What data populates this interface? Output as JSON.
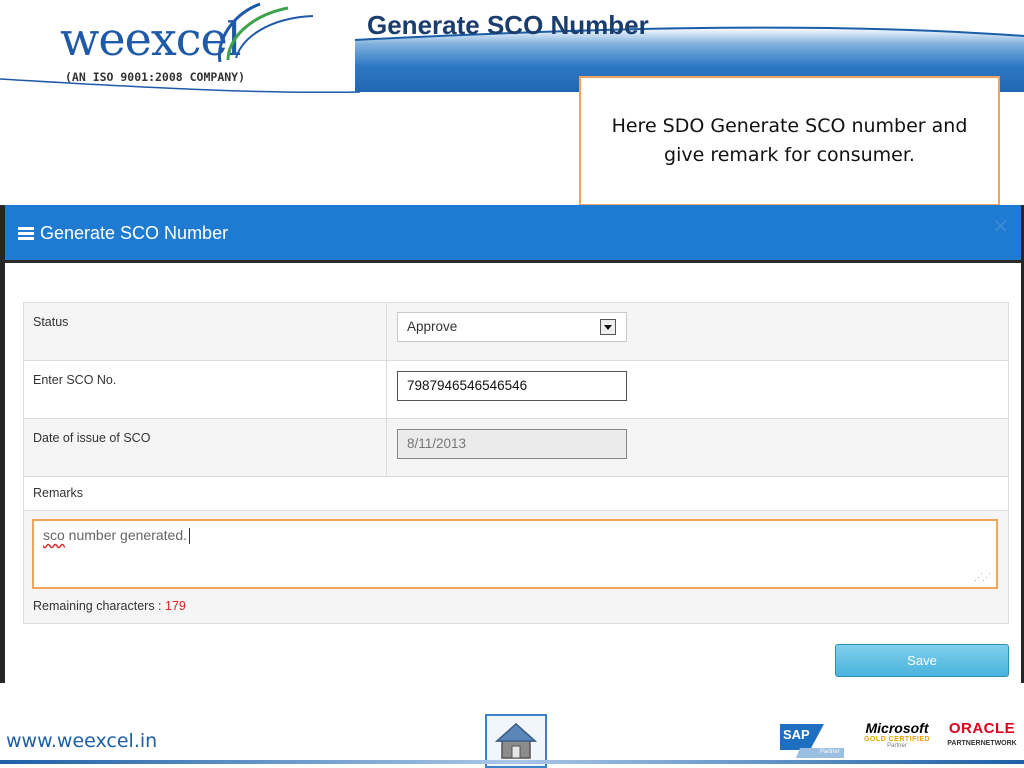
{
  "header": {
    "logo_text": "weexcel",
    "logo_tagline": "(AN ISO 9001:2008 COMPANY)",
    "slide_title": "Generate SCO Number"
  },
  "callout": {
    "text": "Here SDO Generate SCO number and give remark for consumer."
  },
  "modal": {
    "title": "Generate SCO Number",
    "close_label": "✕",
    "fields": {
      "status": {
        "label": "Status",
        "value": "Approve"
      },
      "sco_no": {
        "label": "Enter SCO No.",
        "value": "7987946546546546"
      },
      "date_issue": {
        "label": "Date of issue of SCO",
        "value": "8/11/2013"
      }
    },
    "remarks": {
      "label": "Remarks",
      "value_misspelled": "sco",
      "value_rest": " number generated.",
      "remaining_label": "Remaining characters :",
      "remaining_count": "179"
    },
    "save_label": "Save"
  },
  "footer": {
    "url": "www.weexcel.in",
    "partners": {
      "sap": "SAP",
      "sap_sub": "Partner",
      "microsoft": "Microsoft",
      "microsoft_cert": "GOLD CERTIFIED",
      "microsoft_sub": "Partner",
      "oracle": "ORACLE",
      "oracle_sub": "PARTNERNETWORK"
    }
  },
  "colors": {
    "modal_header": "#1f7bd1",
    "callout_border": "#f0a15e",
    "remaining_count": "#e02020",
    "brand_blue": "#1e5aa8"
  }
}
